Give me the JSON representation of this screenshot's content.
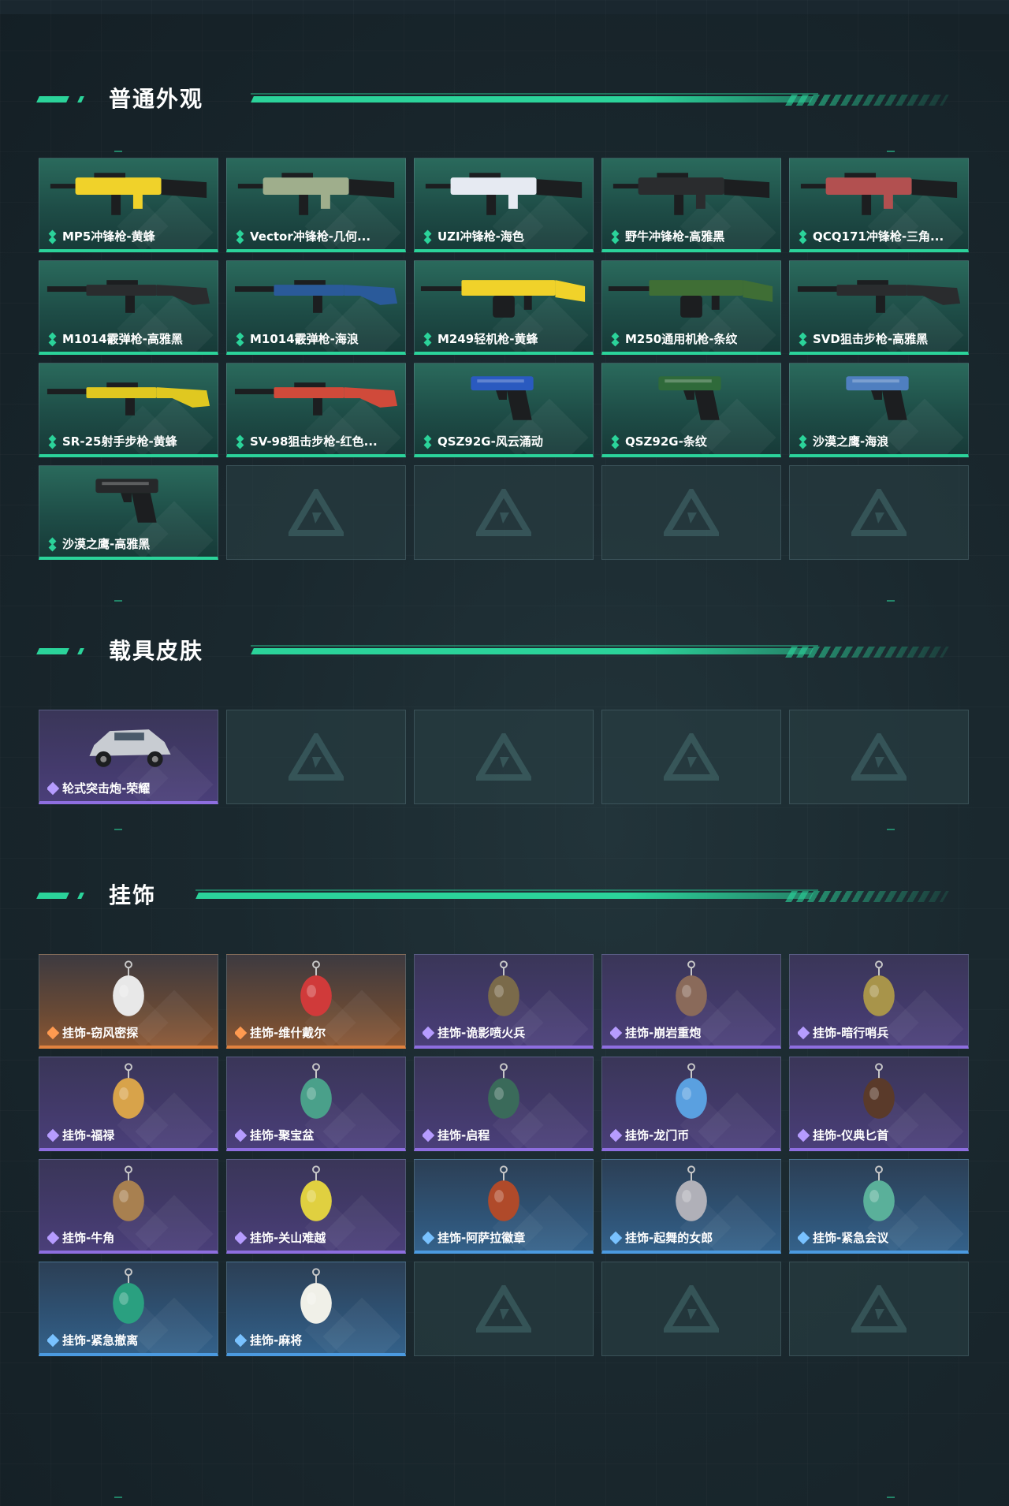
{
  "sections": [
    {
      "title": "普通外观",
      "items": [
        {
          "label": "MP5冲锋枪-黄蜂",
          "rarity": "green",
          "icon": "smg-icon",
          "color": "#f0d22a"
        },
        {
          "label": "Vector冲锋枪-几何...",
          "rarity": "green",
          "icon": "smg-icon",
          "color": "#9fae8c"
        },
        {
          "label": "UZI冲锋枪-海色",
          "rarity": "green",
          "icon": "smg-icon",
          "color": "#e6eaf2"
        },
        {
          "label": "野牛冲锋枪-高雅黑",
          "rarity": "green",
          "icon": "smg-icon",
          "color": "#2a2c2e"
        },
        {
          "label": "QCQ171冲锋枪-三角...",
          "rarity": "green",
          "icon": "smg-icon",
          "color": "#b25050"
        },
        {
          "label": "M1014霰弹枪-高雅黑",
          "rarity": "green",
          "icon": "shotgun-icon",
          "color": "#2a2c2e"
        },
        {
          "label": "M1014霰弹枪-海浪",
          "rarity": "green",
          "icon": "shotgun-icon",
          "color": "#2a5a9a"
        },
        {
          "label": "M249轻机枪-黄蜂",
          "rarity": "green",
          "icon": "machine-gun-icon",
          "color": "#f0d22a"
        },
        {
          "label": "M250通用机枪-条纹",
          "rarity": "green",
          "icon": "machine-gun-icon",
          "color": "#3f6e35"
        },
        {
          "label": "SVD狙击步枪-高雅黑",
          "rarity": "green",
          "icon": "rifle-icon",
          "color": "#2a2c2e"
        },
        {
          "label": "SR-25射手步枪-黄蜂",
          "rarity": "green",
          "icon": "rifle-icon",
          "color": "#e0c820"
        },
        {
          "label": "SV-98狙击步枪-红色...",
          "rarity": "green",
          "icon": "rifle-icon",
          "color": "#d04a3a"
        },
        {
          "label": "QSZ92G-风云涌动",
          "rarity": "green",
          "icon": "pistol-icon",
          "color": "#2a5ac0"
        },
        {
          "label": "QSZ92G-条纹",
          "rarity": "green",
          "icon": "pistol-icon",
          "color": "#2f6a3a"
        },
        {
          "label": "沙漠之鹰-海浪",
          "rarity": "green",
          "icon": "pistol-icon",
          "color": "#4f7fc0"
        },
        {
          "label": "沙漠之鹰-高雅黑",
          "rarity": "green",
          "icon": "pistol-icon",
          "color": "#26282a"
        }
      ]
    },
    {
      "title": "载具皮肤",
      "items": [
        {
          "label": "轮式突击炮-荣耀",
          "rarity": "purple",
          "icon": "vehicle-icon",
          "color": "#c8ccd2"
        }
      ]
    },
    {
      "title": "挂饰",
      "items": [
        {
          "label": "挂饰-窃风密探",
          "rarity": "orange",
          "icon": "charm-icon",
          "color": "#e8e8e8"
        },
        {
          "label": "挂饰-维什戴尔",
          "rarity": "orange",
          "icon": "charm-icon",
          "color": "#d03a3a"
        },
        {
          "label": "挂饰-诡影喷火兵",
          "rarity": "purple",
          "icon": "charm-icon",
          "color": "#7a6a4a"
        },
        {
          "label": "挂饰-崩岩重炮",
          "rarity": "purple",
          "icon": "charm-icon",
          "color": "#8a6a5a"
        },
        {
          "label": "挂饰-暗行哨兵",
          "rarity": "purple",
          "icon": "charm-icon",
          "color": "#a8944a"
        },
        {
          "label": "挂饰-福禄",
          "rarity": "purple",
          "icon": "charm-icon",
          "color": "#d8a34a"
        },
        {
          "label": "挂饰-聚宝盆",
          "rarity": "purple",
          "icon": "charm-icon",
          "color": "#4aa08a"
        },
        {
          "label": "挂饰-启程",
          "rarity": "purple",
          "icon": "charm-icon",
          "color": "#3a6a5a"
        },
        {
          "label": "挂饰-龙门币",
          "rarity": "purple",
          "icon": "charm-icon",
          "color": "#5aa0e0"
        },
        {
          "label": "挂饰-仪典匕首",
          "rarity": "purple",
          "icon": "charm-icon",
          "color": "#5a3a2a"
        },
        {
          "label": "挂饰-牛角",
          "rarity": "purple",
          "icon": "charm-icon",
          "color": "#a88050"
        },
        {
          "label": "挂饰-关山难越",
          "rarity": "purple",
          "icon": "charm-icon",
          "color": "#e0d040"
        },
        {
          "label": "挂饰-阿萨拉徽章",
          "rarity": "blue",
          "icon": "charm-icon",
          "color": "#b04a2a"
        },
        {
          "label": "挂饰-起舞的女郎",
          "rarity": "blue",
          "icon": "charm-icon",
          "color": "#b0b0b8"
        },
        {
          "label": "挂饰-紧急会议",
          "rarity": "blue",
          "icon": "charm-icon",
          "color": "#5ab09a"
        },
        {
          "label": "挂饰-紧急撤离",
          "rarity": "blue",
          "icon": "charm-icon",
          "color": "#2aa080"
        },
        {
          "label": "挂饰-麻将",
          "rarity": "blue",
          "icon": "charm-icon",
          "color": "#f0f0e8"
        }
      ]
    }
  ],
  "colors": {
    "accent_green": "#2bd39a",
    "rarity_purple": "#8e6ee0",
    "rarity_orange": "#e1823f",
    "rarity_blue": "#4b9ae0"
  }
}
